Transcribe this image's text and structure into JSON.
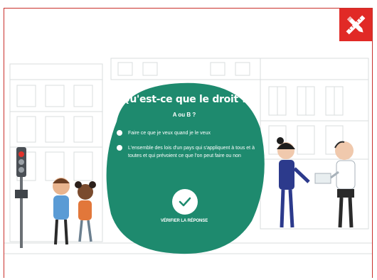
{
  "quiz": {
    "title": "Qu'est-ce que le droit ?",
    "subtitle": "A ou B ?",
    "options": [
      {
        "label": "Faire ce que je veux quand je le veux"
      },
      {
        "label": "L'ensemble des lois d'un pays qui s'appliquent à tous et à toutes et qui prévoient ce que l'on peut faire ou non"
      }
    ],
    "verify_label": "VÉRIFIER LA RÉPONSE"
  },
  "colors": {
    "card_green": "#1e8a6e",
    "frame_red": "#c9302c",
    "logo_red": "#e12a26"
  },
  "icons": {
    "logo": "pencil-ruler-cross-icon",
    "verify": "check-icon"
  }
}
